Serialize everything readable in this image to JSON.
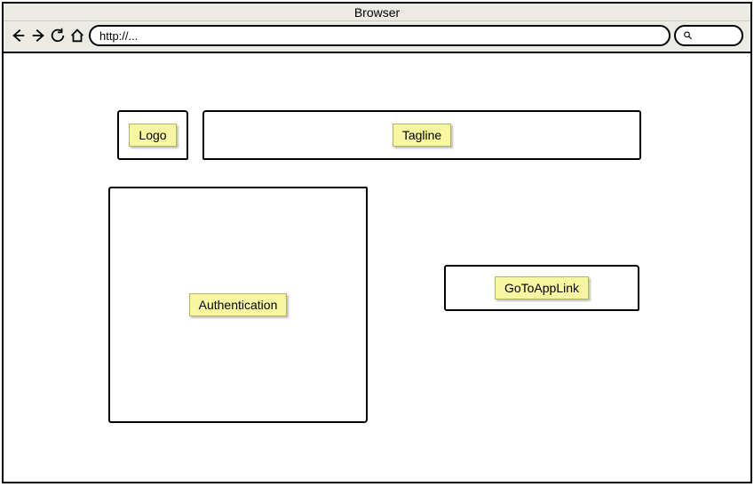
{
  "window": {
    "title": "Browser"
  },
  "toolbar": {
    "url_value": "http://...",
    "search_value": ""
  },
  "wireframe": {
    "logo_label": "Logo",
    "tagline_label": "Tagline",
    "auth_label": "Authentication",
    "goto_label": "GoToAppLink"
  },
  "icons": {
    "back": "back-arrow-icon",
    "forward": "forward-arrow-icon",
    "reload": "reload-icon",
    "home": "home-icon",
    "search": "search-icon"
  }
}
